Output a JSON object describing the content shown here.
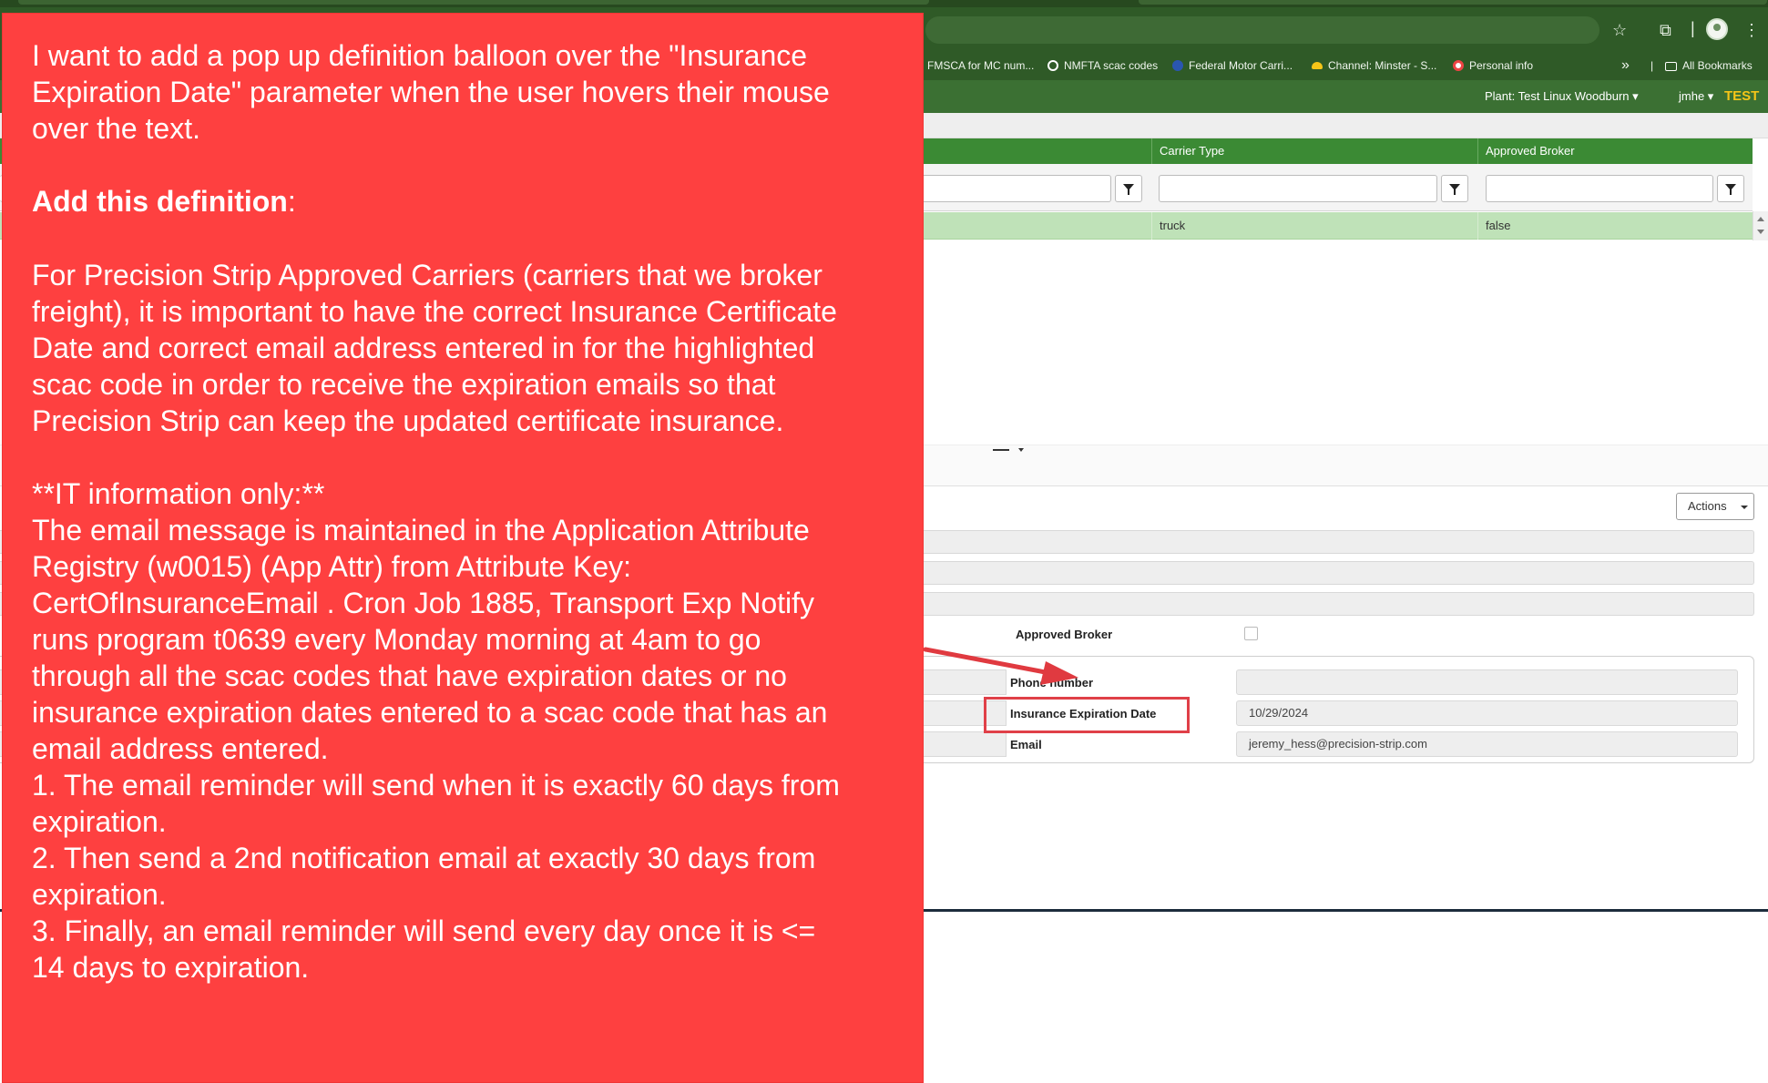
{
  "bookmarks": {
    "items": [
      {
        "label": "FMSCA for MC num...",
        "color": "#6fa0d8"
      },
      {
        "label": "NMFTA scac codes",
        "color": "#ffffff"
      },
      {
        "label": "Federal Motor Carri...",
        "color": "#2a56b0"
      },
      {
        "label": "Channel: Minster - S...",
        "color": "#f5c518"
      },
      {
        "label": "Personal info",
        "color": "#ffffff"
      }
    ],
    "overflow": "»",
    "all_label": "All Bookmarks"
  },
  "header": {
    "plant": "Plant: Test Linux Woodburn",
    "user": "jmhe",
    "env": "TEST"
  },
  "grid": {
    "columns": [
      "Carrier Type",
      "Approved Broker"
    ],
    "row": [
      "truck",
      "false"
    ]
  },
  "detail": {
    "actions_label": "Actions",
    "approved_broker_label": "Approved Broker",
    "phone_label": "Phone number",
    "phone_value": "",
    "insurance_label": "Insurance Expiration Date",
    "insurance_value": "10/29/2024",
    "email_label": "Email",
    "email_value": "jeremy_hess@precision-strip.com"
  },
  "note": {
    "intro": [
      "I want to add a pop up definition balloon over the \"Insurance",
      "Expiration Date\" parameter when the user hovers their mouse",
      "over the text."
    ],
    "heading_bold": "Add this definition",
    "heading_rest": ":",
    "definition": [
      "For Precision Strip Approved Carriers (carriers that we broker",
      "freight), it is important to have the correct Insurance Certificate",
      "Date and correct email address entered in for the highlighted",
      "scac code in order to receive the expiration emails so that",
      "Precision Strip can keep the updated certificate insurance."
    ],
    "it_lines": [
      "**IT information only:**",
      "The email message is maintained in the Application Attribute",
      "Registry (w0015) (App Attr) from Attribute Key:",
      "CertOfInsuranceEmail . Cron Job 1885, Transport Exp Notify",
      "runs program t0639 every Monday morning at 4am to go",
      "through all the scac codes that have expiration dates or no",
      "insurance expiration dates entered to a scac code that has an",
      "email address entered.",
      "1. The email reminder will send when it is exactly 60 days from",
      "expiration.",
      "2. Then send a 2nd notification email at exactly 30 days from",
      "expiration.",
      "3. Finally, an email reminder will send every day once it is <=",
      "14 days to expiration."
    ]
  },
  "colors": {
    "chrome": "#2f5a27",
    "app_header": "#3b7033",
    "grid_header": "#3b8a34",
    "selected_row": "#bfe2b8",
    "note_bg": "#fe4040",
    "highlight": "#e04048",
    "env": "#f5c518"
  }
}
